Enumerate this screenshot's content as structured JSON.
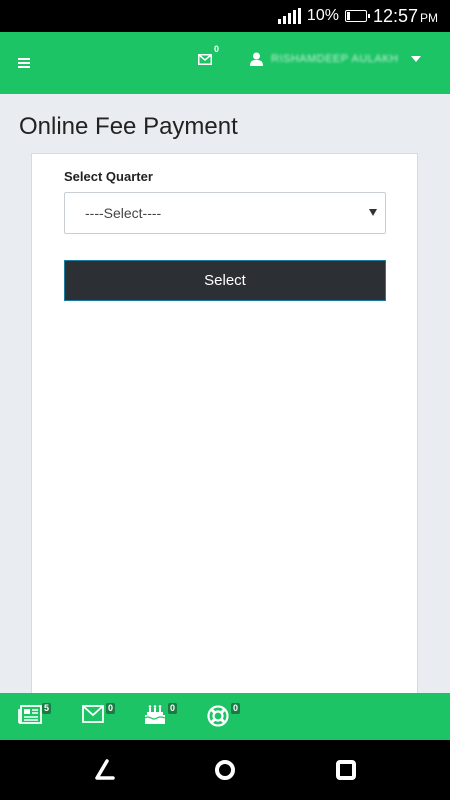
{
  "status_bar": {
    "battery": "10%",
    "time": "12:57",
    "ampm": "PM"
  },
  "header": {
    "mail_count": "0",
    "user_name": "RISHAMDEEP AULAKH"
  },
  "page": {
    "title": "Online Fee Payment"
  },
  "form": {
    "quarter_label": "Select Quarter",
    "quarter_value": "----Select----",
    "submit_label": "Select"
  },
  "bottom_bar": {
    "items": [
      {
        "icon": "newspaper-icon",
        "count": "5"
      },
      {
        "icon": "mail-icon",
        "count": "0"
      },
      {
        "icon": "birthday-cake-icon",
        "count": "0"
      },
      {
        "icon": "lifebuoy-icon",
        "count": "0"
      }
    ]
  },
  "colors": {
    "brand": "#1cc465",
    "button": "#2c2f33",
    "background": "#e9edf2"
  }
}
